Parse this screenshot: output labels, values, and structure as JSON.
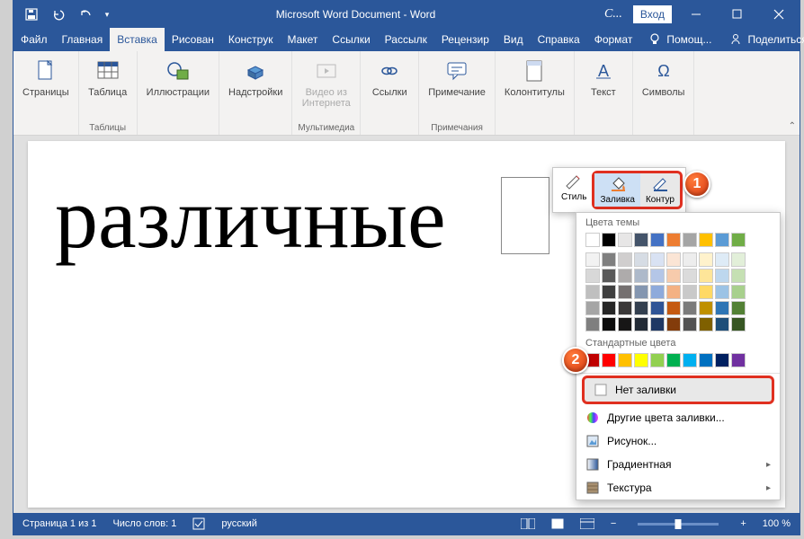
{
  "titlebar": {
    "title": "Microsoft Word Document  -  Word",
    "login": "Вход"
  },
  "menubar": {
    "items": [
      "Файл",
      "Главная",
      "Вставка",
      "Рисован",
      "Конструк",
      "Макет",
      "Ссылки",
      "Рассылк",
      "Рецензир",
      "Вид",
      "Справка",
      "Формат"
    ],
    "active_index": 2,
    "tell_me": "Помощ...",
    "share": "Поделиться"
  },
  "ribbon": {
    "groups": [
      {
        "label": "",
        "buttons": [
          {
            "label": "Страницы",
            "icon": "page"
          }
        ]
      },
      {
        "label": "Таблицы",
        "buttons": [
          {
            "label": "Таблица",
            "icon": "table"
          }
        ]
      },
      {
        "label": "",
        "buttons": [
          {
            "label": "Иллюстрации",
            "icon": "illustrations"
          }
        ]
      },
      {
        "label": "",
        "buttons": [
          {
            "label": "Надстройки",
            "icon": "addins"
          }
        ]
      },
      {
        "label": "Мультимедиа",
        "buttons": [
          {
            "label": "Видео из\nИнтернета",
            "icon": "video",
            "disabled": true
          }
        ]
      },
      {
        "label": "",
        "buttons": [
          {
            "label": "Ссылки",
            "icon": "links"
          }
        ]
      },
      {
        "label": "Примечания",
        "buttons": [
          {
            "label": "Примечание",
            "icon": "comment"
          }
        ]
      },
      {
        "label": "",
        "buttons": [
          {
            "label": "Колонтитулы",
            "icon": "headers"
          }
        ]
      },
      {
        "label": "",
        "buttons": [
          {
            "label": "Текст",
            "icon": "text"
          }
        ]
      },
      {
        "label": "",
        "buttons": [
          {
            "label": "Символы",
            "icon": "symbols"
          }
        ]
      }
    ]
  },
  "document": {
    "text": "различные"
  },
  "mini_toolbar": {
    "style": "Стиль",
    "fill": "Заливка",
    "outline": "Контур"
  },
  "color_panel": {
    "theme_label": "Цвета темы",
    "standard_label": "Стандартные цвета",
    "no_fill": "Нет заливки",
    "more_colors": "Другие цвета заливки...",
    "picture": "Рисунок...",
    "gradient": "Градиентная",
    "texture": "Текстура",
    "theme_row1": [
      "#ffffff",
      "#000000",
      "#e7e6e6",
      "#44546a",
      "#4472c4",
      "#ed7d31",
      "#a5a5a5",
      "#ffc000",
      "#5b9bd5",
      "#70ad47"
    ],
    "theme_shades": [
      [
        "#f2f2f2",
        "#7f7f7f",
        "#d0cece",
        "#d6dce4",
        "#d9e2f3",
        "#fbe5d5",
        "#ededed",
        "#fff2cc",
        "#deebf6",
        "#e2efd9"
      ],
      [
        "#d8d8d8",
        "#595959",
        "#aeabab",
        "#adb9ca",
        "#b4c6e7",
        "#f7cbac",
        "#dbdbdb",
        "#fee599",
        "#bdd7ee",
        "#c5e0b3"
      ],
      [
        "#bfbfbf",
        "#3f3f3f",
        "#757070",
        "#8496b0",
        "#8eaadb",
        "#f4b183",
        "#c9c9c9",
        "#ffd965",
        "#9cc3e5",
        "#a8d08d"
      ],
      [
        "#a5a5a5",
        "#262626",
        "#3a3838",
        "#333f4f",
        "#2f5496",
        "#c55a11",
        "#7b7b7b",
        "#bf9000",
        "#2e75b5",
        "#538135"
      ],
      [
        "#7f7f7f",
        "#0c0c0c",
        "#171616",
        "#222a35",
        "#1f3864",
        "#833c0b",
        "#525252",
        "#7f6000",
        "#1e4e79",
        "#375623"
      ]
    ],
    "standard_colors": [
      "#c00000",
      "#ff0000",
      "#ffc000",
      "#ffff00",
      "#92d050",
      "#00b050",
      "#00b0f0",
      "#0070c0",
      "#002060",
      "#7030a0"
    ]
  },
  "statusbar": {
    "page": "Страница 1 из 1",
    "word_count": "Число слов: 1",
    "language": "русский",
    "zoom": "100 %"
  },
  "callouts": {
    "c1": "1",
    "c2": "2"
  }
}
